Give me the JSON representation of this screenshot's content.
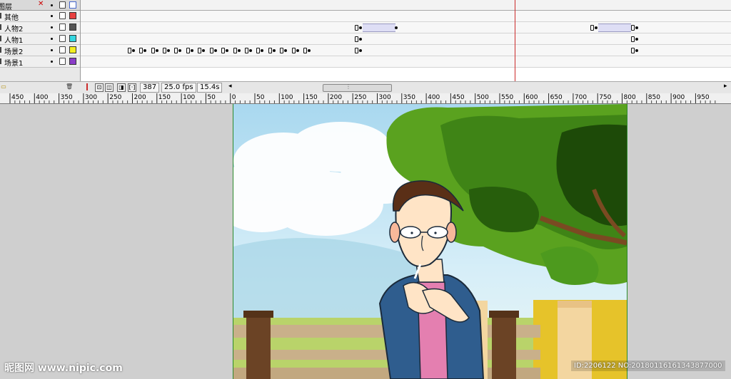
{
  "timeline": {
    "header_title": "图层",
    "layers": [
      {
        "name": "其他",
        "color": "#e84040"
      },
      {
        "name": "人物2",
        "color": "#555555"
      },
      {
        "name": "人物1",
        "color": "#34d6e0"
      },
      {
        "name": "场景2",
        "color": "#f2ee22"
      },
      {
        "name": "场景1",
        "color": "#8a3cc8"
      }
    ]
  },
  "statusbar": {
    "current_frame": "387",
    "frame_rate": "25.0 fps",
    "elapsed_time": "15.4s"
  },
  "ruler": {
    "labels": [
      "450",
      "400",
      "350",
      "300",
      "250",
      "200",
      "150",
      "100",
      "50",
      "0",
      "50",
      "100",
      "150",
      "200",
      "250",
      "300",
      "350",
      "400",
      "450",
      "500",
      "550",
      "600",
      "650",
      "700",
      "750",
      "800",
      "850",
      "900",
      "950"
    ]
  },
  "watermark": {
    "left_text": "昵图网 www.nipic.com",
    "right_text": "ID:2206122 NO:20180116161343877000"
  },
  "colors": {
    "playhead": "#cc2b2b",
    "stage_border": "#2c8a2c",
    "sky": "#b9dff1",
    "tree": "#4f9a1d"
  },
  "icons": [
    "eye-icon",
    "lock-icon",
    "outline-icon",
    "folder-icon",
    "trash-icon",
    "onion-skin-icon",
    "edit-multiple-frames-icon",
    "center-frame-icon"
  ]
}
